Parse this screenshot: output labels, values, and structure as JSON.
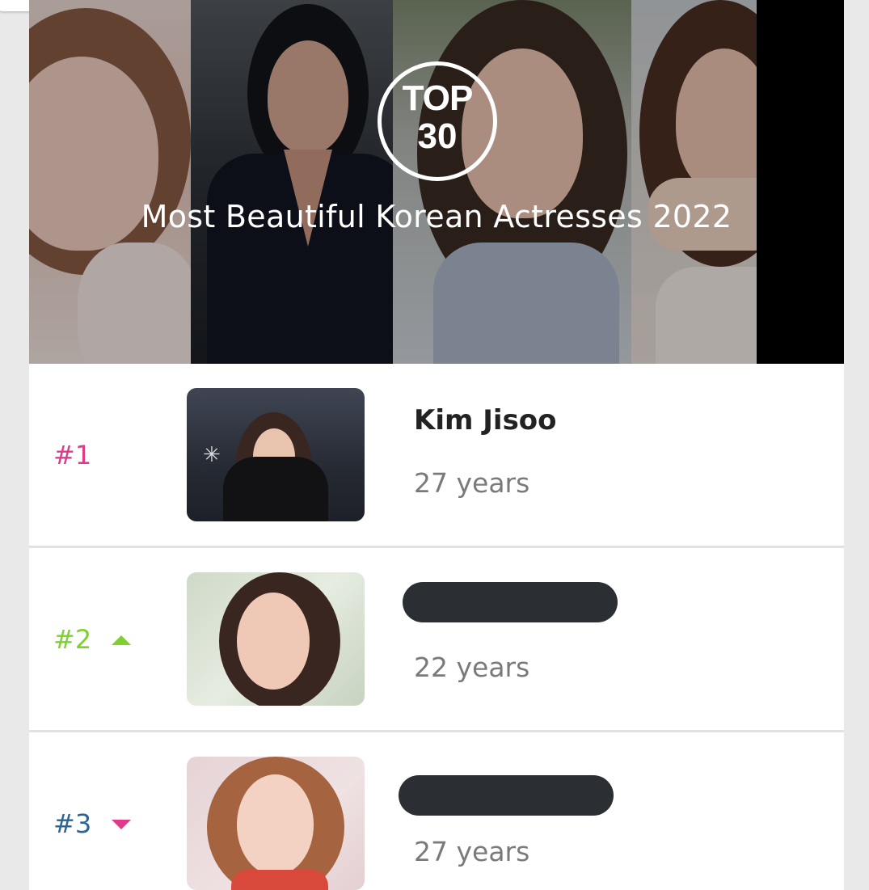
{
  "hero": {
    "badge_top": "TOP",
    "badge_number": "30",
    "title": "Most Beautiful Korean Actresses 2022"
  },
  "colors": {
    "rank_1": "#e13a8a",
    "rank_2": "#7dd12f",
    "rank_3": "#2a6496",
    "trend_up": "#7dd12f",
    "trend_down": "#e13a8a"
  },
  "entries": [
    {
      "rank": "#1",
      "name": "Kim Jisoo",
      "age": "27 years",
      "trend": "none",
      "name_redacted": false
    },
    {
      "rank": "#2",
      "name": "",
      "age": "22 years",
      "trend": "up",
      "name_redacted": true
    },
    {
      "rank": "#3",
      "name": "",
      "age": "27 years",
      "trend": "down",
      "name_redacted": true
    }
  ]
}
